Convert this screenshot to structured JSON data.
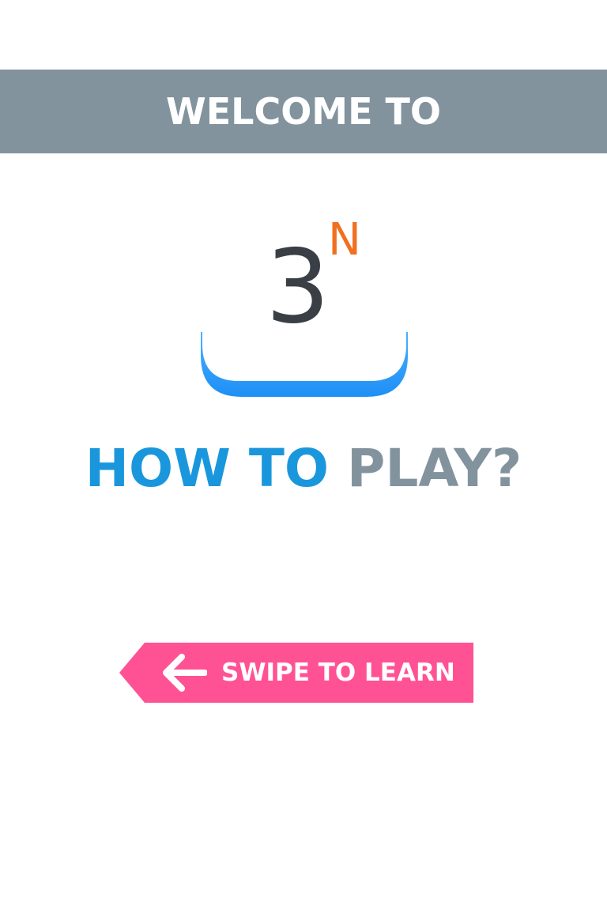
{
  "header": {
    "title": "WELCOME TO"
  },
  "logo": {
    "base": "3",
    "exponent": "N"
  },
  "heading": {
    "part1": "HOW TO",
    "part2": "PLAY?"
  },
  "swipe_button": {
    "label": "SWIPE TO LEARN",
    "icon": "arrow-left-icon"
  },
  "colors": {
    "banner": "#82939e",
    "logo_text": "#3a3f45",
    "logo_exponent": "#f07020",
    "logo_base": "#2196f3",
    "heading_blue": "#1a97dc",
    "heading_gray": "#82939e",
    "ribbon": "#ff5294"
  }
}
